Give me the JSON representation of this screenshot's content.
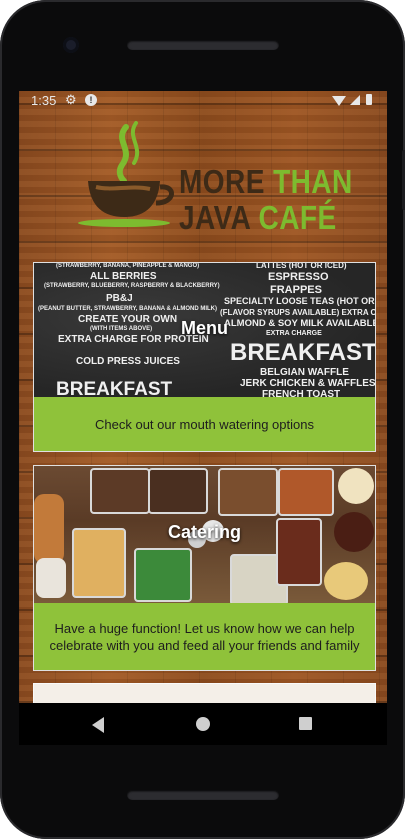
{
  "status_bar": {
    "time": "1:35"
  },
  "logo": {
    "line1_dark": "MORE ",
    "line1_green": "THAN",
    "line2_dark": "JAVA ",
    "line2_green": "CAFÉ"
  },
  "cards": [
    {
      "title": "Menu",
      "description": "Check out our mouth watering options",
      "chalk_left": [
        "(STRAWBERRY, BANANA, PINEAPPLE & MANGO)",
        "ALL BERRIES",
        "(STRAWBERRY, BLUEBERRY, RASPBERRY & BLACKBERRY)",
        "PB&J",
        "(PEANUT BUTTER, STRAWBERRY, BANANA & ALMOND MILK)",
        "CREATE YOUR OWN",
        "(WITH ITEMS ABOVE)",
        "EXTRA CHARGE FOR PROTEIN",
        "COLD PRESS JUICES",
        "BREAKFAST"
      ],
      "chalk_right": [
        "LATTES (HOT OR ICED)",
        "ESPRESSO",
        "FRAPPES",
        "SPECIALTY LOOSE TEAS (HOT OR ICED)",
        "(FLAVOR SYRUPS AVAILABLE) EXTRA CHARGE",
        "ALMOND & SOY MILK AVAILABLE",
        "EXTRA CHARGE",
        "BREAKFAST",
        "BELGIAN WAFFLE",
        "JERK CHICKEN & WAFFLES",
        "FRENCH TOAST"
      ]
    },
    {
      "title": "Catering",
      "description": "Have a huge function! Let us know how we can help celebrate with you and feed all your friends and family"
    }
  ],
  "colors": {
    "accent_green": "#8fc23a",
    "logo_dark": "#3d2a17",
    "logo_green": "#7dbb2f"
  }
}
